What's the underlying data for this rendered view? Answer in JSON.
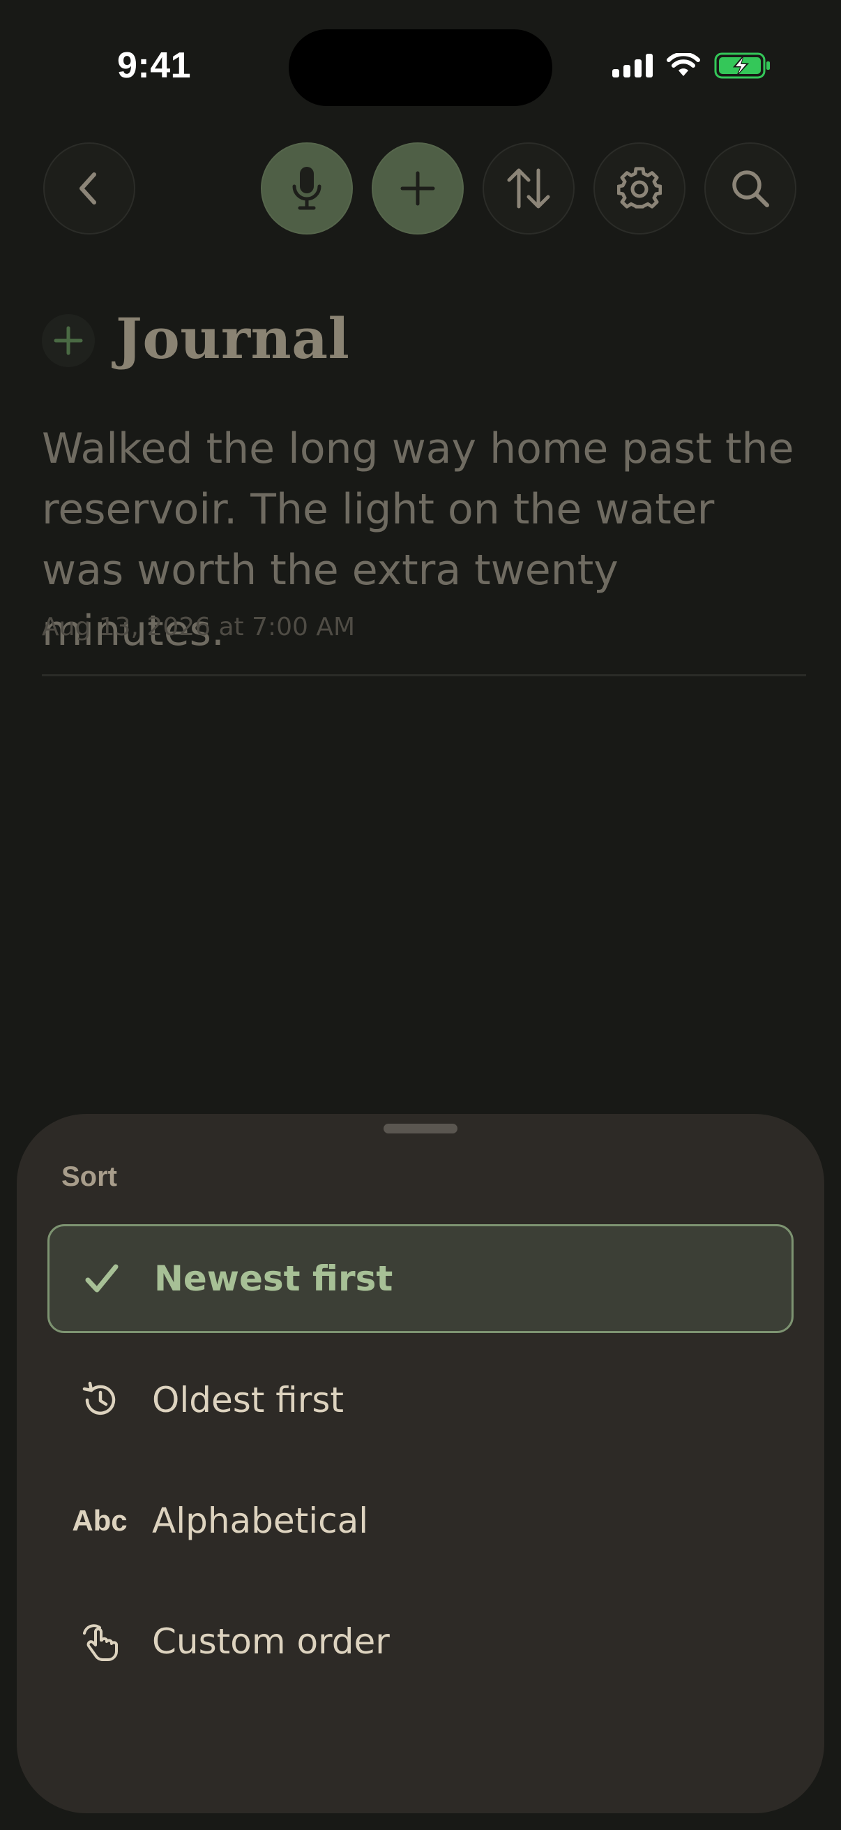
{
  "status_bar": {
    "time": "9:41"
  },
  "toolbar": {
    "back_icon": "chevron-left-icon",
    "mic_icon": "microphone-icon",
    "add_icon": "plus-icon",
    "sort_icon": "sort-arrows-icon",
    "settings_icon": "gear-icon",
    "search_icon": "search-icon"
  },
  "journal": {
    "title": "Journal",
    "entry": {
      "text": "Walked the long way home past the reservoir. The light on the water was worth the extra twenty minutes.",
      "date": "Aug 13, 2026 at 7:00 AM"
    }
  },
  "sort_sheet": {
    "title": "Sort",
    "options": [
      {
        "label": "Newest first",
        "icon": "checkmark-icon",
        "selected": true
      },
      {
        "label": "Oldest first",
        "icon": "history-clock-icon",
        "selected": false
      },
      {
        "label": "Alphabetical",
        "icon": "Abc",
        "selected": false
      },
      {
        "label": "Custom order",
        "icon": "hand-tap-icon",
        "selected": false
      }
    ]
  },
  "colors": {
    "background": "#181916",
    "accent_green": "#4f5f46",
    "selected_text": "#a7c096",
    "battery_green": "#34c759"
  }
}
